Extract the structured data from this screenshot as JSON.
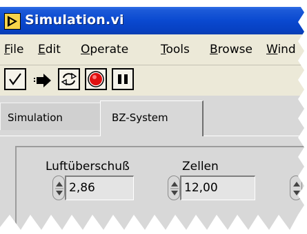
{
  "window": {
    "title": "Simulation.vi"
  },
  "menu": {
    "items": [
      {
        "label": "File",
        "accel": "F",
        "rest": "ile"
      },
      {
        "label": "Edit",
        "accel": "E",
        "rest": "dit"
      },
      {
        "label": "Operate",
        "accel": "O",
        "rest": "perate"
      },
      {
        "label": "Tools",
        "accel": "T",
        "rest": "ools"
      },
      {
        "label": "Browse",
        "accel": "B",
        "rest": "rowse"
      },
      {
        "label": "Wind",
        "accel": "W",
        "rest": "ind"
      }
    ]
  },
  "toolbar": {
    "buttons": [
      {
        "name": "checkmark-icon"
      },
      {
        "name": "run-arrow-icon"
      },
      {
        "name": "run-continuously-icon"
      },
      {
        "name": "abort-icon"
      },
      {
        "name": "pause-icon"
      }
    ]
  },
  "tabs": [
    {
      "label": "Simulation",
      "selected": false
    },
    {
      "label": "BZ-System",
      "selected": true
    }
  ],
  "controls": {
    "luftueberschuss": {
      "label": "Luftüberschuß",
      "value": "2,86"
    },
    "zellen": {
      "label": "Zellen",
      "value": "12,00"
    }
  },
  "colors": {
    "titlebar": "#0a49d0",
    "menubar": "#ece9d8",
    "panel": "#d8d8d8",
    "abort": "#e01010"
  }
}
